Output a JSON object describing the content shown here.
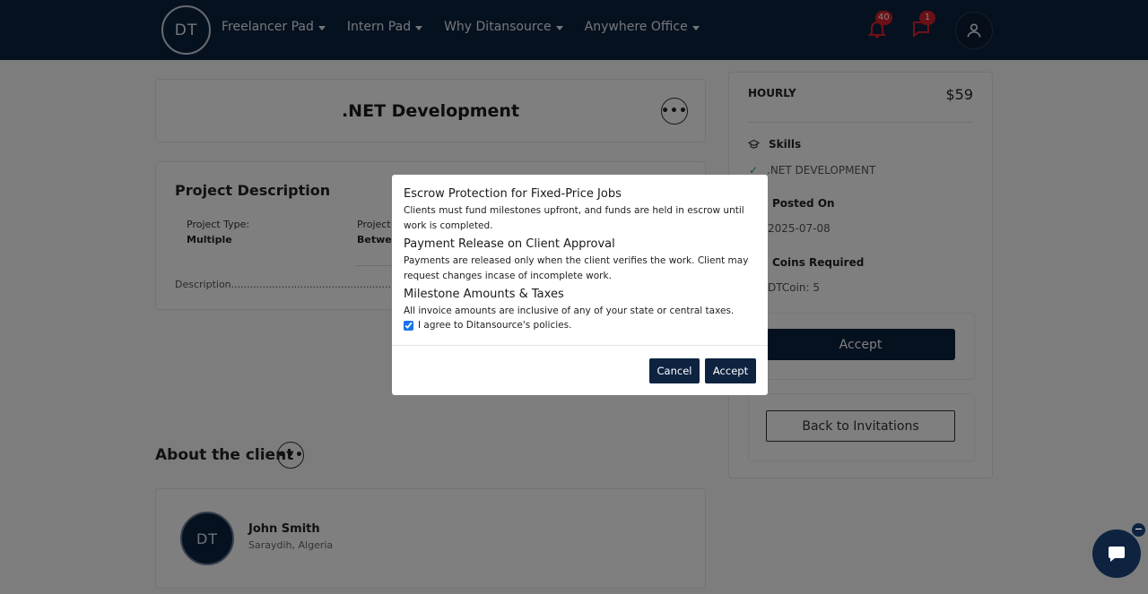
{
  "header": {
    "logo_text": "DT",
    "nav": [
      {
        "label": "Freelancer Pad"
      },
      {
        "label": "Intern Pad"
      },
      {
        "label": "Why Ditansource"
      },
      {
        "label": "Anywhere Office"
      }
    ],
    "notification_count": "40",
    "message_count": "1"
  },
  "project": {
    "title": ".NET Development",
    "description_heading": "Project Description",
    "project_type_label": "Project Type:",
    "project_type_value": "Multiple",
    "project_length_label": "Project L",
    "project_length_value": "Betwee",
    "description_text": "Description..................................................................."
  },
  "client": {
    "heading": "About the client",
    "avatar_text": "DT",
    "name": "John Smith",
    "location": "Saraydih, Algeria"
  },
  "sidebar": {
    "rate_label": "HOURLY",
    "rate_value": "$59",
    "skills_label": "Skills",
    "skill": ".NET DEVELOPMENT",
    "posted_label": "Posted On",
    "posted_value": "2025-07-08",
    "coins_label": "Coins Required",
    "coins_value": "DTCoin: 5",
    "accept_label": "Accept",
    "back_label": "Back to Invitations"
  },
  "modal": {
    "sections": [
      {
        "heading": "Escrow Protection for Fixed-Price Jobs",
        "text": "Clients must fund milestones upfront, and funds are held in escrow until work is completed."
      },
      {
        "heading": "Payment Release on Client Approval",
        "text": "Payments are released only when the client verifies the work. Client may request changes incase of incomplete work."
      },
      {
        "heading": "Milestone Amounts & Taxes",
        "text": "All invoice amounts are inclusive of any of your state or central taxes."
      }
    ],
    "agree_label": "I agree to Ditansource's policies.",
    "agree_checked": true,
    "cancel_label": "Cancel",
    "accept_label": "Accept"
  },
  "chat": {
    "minimize_label": "−"
  }
}
